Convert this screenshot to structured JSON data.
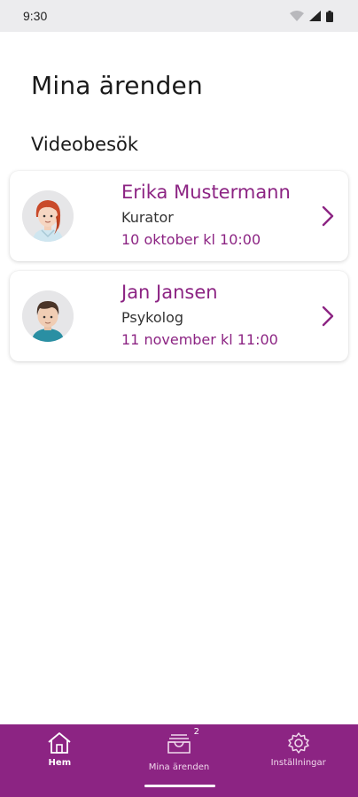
{
  "status_bar": {
    "time": "9:30"
  },
  "page": {
    "title": "Mina ärenden"
  },
  "section": {
    "title": "Videobesök"
  },
  "appointments": [
    {
      "name": "Erika Mustermann",
      "role": "Kurator",
      "date": "10 oktober kl 10:00",
      "avatar": "female-avatar"
    },
    {
      "name": "Jan Jansen",
      "role": "Psykolog",
      "date": "11 november kl 11:00",
      "avatar": "male-avatar"
    }
  ],
  "nav": {
    "items": [
      {
        "label": "Hem",
        "icon": "home-icon",
        "active": true
      },
      {
        "label": "Mina ärenden",
        "icon": "inbox-icon",
        "badge": "2",
        "active": false
      },
      {
        "label": "Inställningar",
        "icon": "gear-icon",
        "active": false
      }
    ]
  },
  "colors": {
    "accent": "#8c2483",
    "status_bar": "#ececee",
    "background": "#ffffff"
  }
}
